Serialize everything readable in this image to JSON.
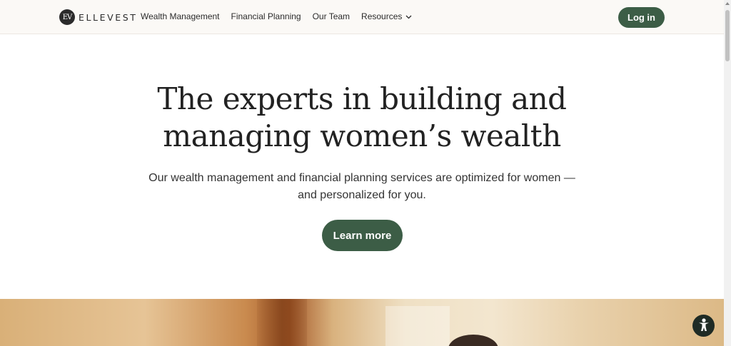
{
  "header": {
    "logo_mark": "EV",
    "logo_text": "ELLEVEST",
    "nav": [
      {
        "label": "Wealth Management"
      },
      {
        "label": "Financial Planning"
      },
      {
        "label": "Our Team"
      },
      {
        "label": "Resources",
        "icon": "chevron-down-icon"
      }
    ],
    "login_label": "Log in"
  },
  "hero": {
    "title_line1": "The experts in building and",
    "title_line2": "managing women’s wealth",
    "subtitle_line1": "Our wealth management and financial planning services are optimized for women —",
    "subtitle_line2": "and personalized for you.",
    "cta_label": "Learn more"
  },
  "accessibility_button": {
    "icon": "accessibility-icon"
  },
  "colors": {
    "accent": "#3c5d46",
    "header_bg": "#fbf9f6",
    "text": "#222222"
  }
}
